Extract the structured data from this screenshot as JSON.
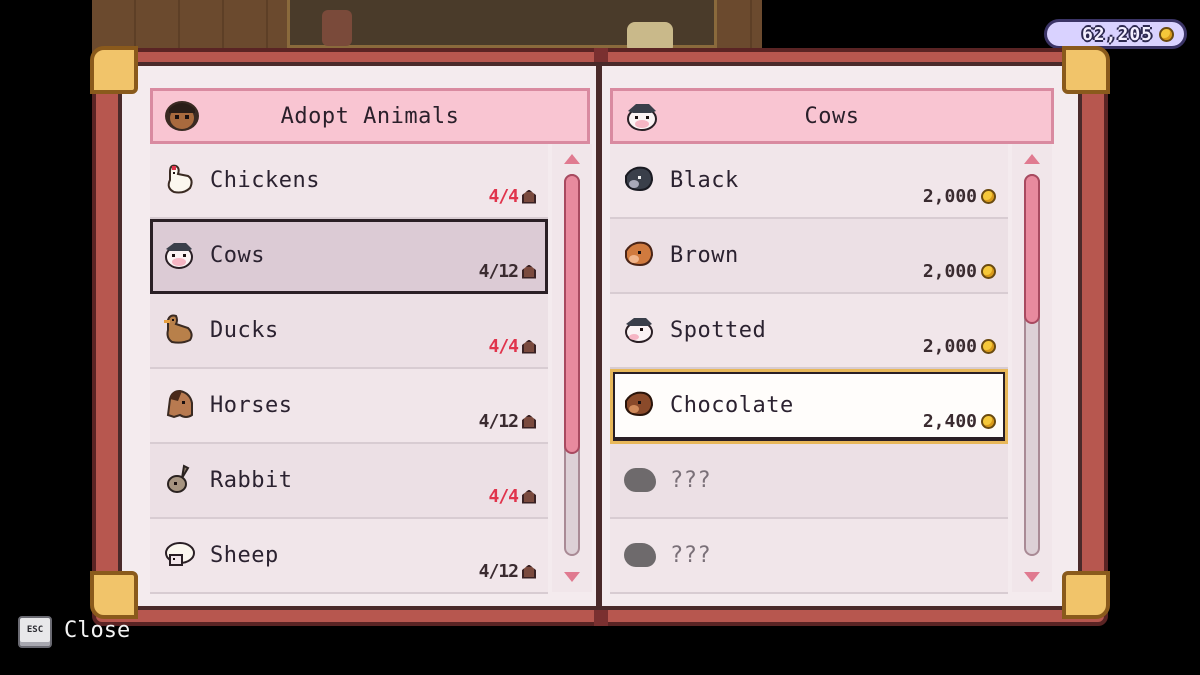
{
  "currency": {
    "amount": "62,205",
    "icon": "coin-icon"
  },
  "left_panel": {
    "title": "Adopt Animals",
    "icon": "farmer-portrait-icon",
    "items": [
      {
        "name": "Chickens",
        "count": "4/4",
        "icon": "chicken-icon",
        "full": true
      },
      {
        "name": "Cows",
        "count": "4/12",
        "icon": "cow-icon",
        "full": false,
        "selected": true
      },
      {
        "name": "Ducks",
        "count": "4/4",
        "icon": "duck-icon",
        "full": true
      },
      {
        "name": "Horses",
        "count": "4/12",
        "icon": "horse-icon",
        "full": false
      },
      {
        "name": "Rabbit",
        "count": "4/4",
        "icon": "rabbit-icon",
        "full": true
      },
      {
        "name": "Sheep",
        "count": "4/12",
        "icon": "sheep-icon",
        "full": false
      }
    ]
  },
  "right_panel": {
    "title": "Cows",
    "icon": "cow-icon",
    "items": [
      {
        "name": "Black",
        "price": "2,000",
        "icon": "black-cow-icon"
      },
      {
        "name": "Brown",
        "price": "2,000",
        "icon": "brown-cow-icon"
      },
      {
        "name": "Spotted",
        "price": "2,000",
        "icon": "spotted-cow-icon"
      },
      {
        "name": "Chocolate",
        "price": "2,400",
        "icon": "chocolate-cow-icon",
        "hover": true
      },
      {
        "name": "???",
        "price": "",
        "icon": "locked-silhouette-icon",
        "locked": true
      },
      {
        "name": "???",
        "price": "",
        "icon": "locked-silhouette-icon",
        "locked": true
      }
    ]
  },
  "footer": {
    "key": "ESC",
    "close_label": "Close"
  },
  "colors": {
    "accent_pink": "#f9c5d2",
    "count_full": "#e0344c",
    "book_cover": "#b7574f",
    "coin": "#f5c83a"
  }
}
